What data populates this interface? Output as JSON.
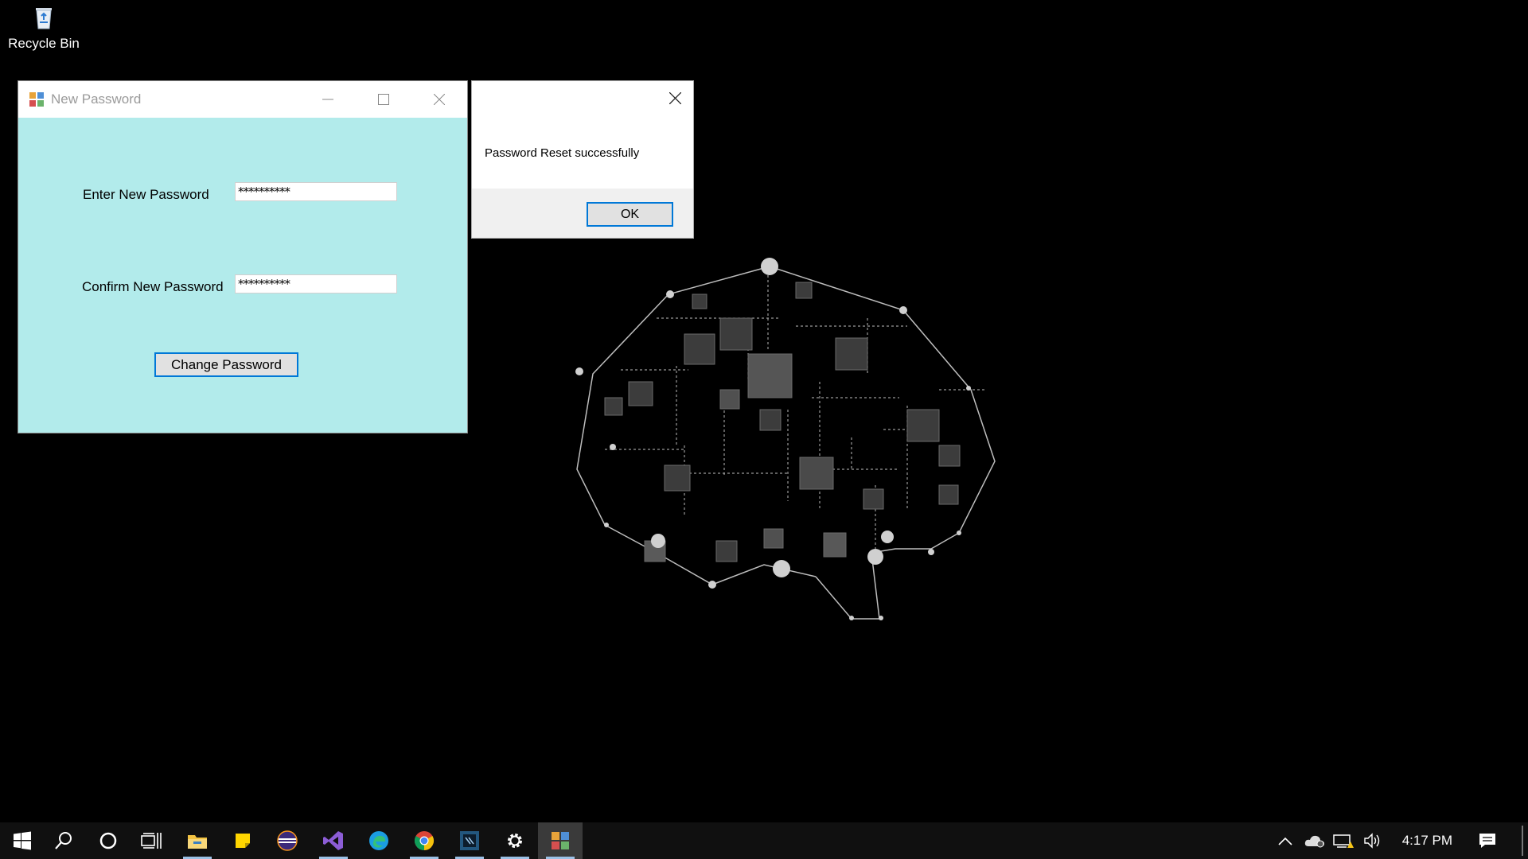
{
  "desktop": {
    "icons": [
      {
        "label": "Recycle Bin",
        "icon": "recycle-bin-icon"
      }
    ]
  },
  "new_password_window": {
    "title": "New Password",
    "enter_label": "Enter New Password",
    "enter_value": "**********",
    "confirm_label": "Confirm New Password",
    "confirm_value": "**********",
    "change_button": "Change Password",
    "background_color": "#b2ebeb"
  },
  "message_box": {
    "text": "Password Reset successfully",
    "ok_button": "OK"
  },
  "taskbar": {
    "items": [
      {
        "icon": "windows-start-icon"
      },
      {
        "icon": "search-icon"
      },
      {
        "icon": "cortana-icon"
      },
      {
        "icon": "task-view-icon"
      },
      {
        "icon": "file-explorer-icon",
        "running": true
      },
      {
        "icon": "sticky-notes-icon"
      },
      {
        "icon": "eclipse-icon"
      },
      {
        "icon": "visual-studio-icon",
        "running": true
      },
      {
        "icon": "edge-icon"
      },
      {
        "icon": "chrome-icon",
        "running": true
      },
      {
        "icon": "pycharm-icon",
        "running": true
      },
      {
        "icon": "settings-icon",
        "running": true
      },
      {
        "icon": "new-password-app-icon",
        "running": true,
        "active": true
      }
    ],
    "tray": {
      "icons": [
        "chevron-up-icon",
        "onedrive-icon",
        "network-warning-icon",
        "volume-icon"
      ],
      "time": "4:17 PM"
    },
    "accent": "#9bc1e6"
  }
}
